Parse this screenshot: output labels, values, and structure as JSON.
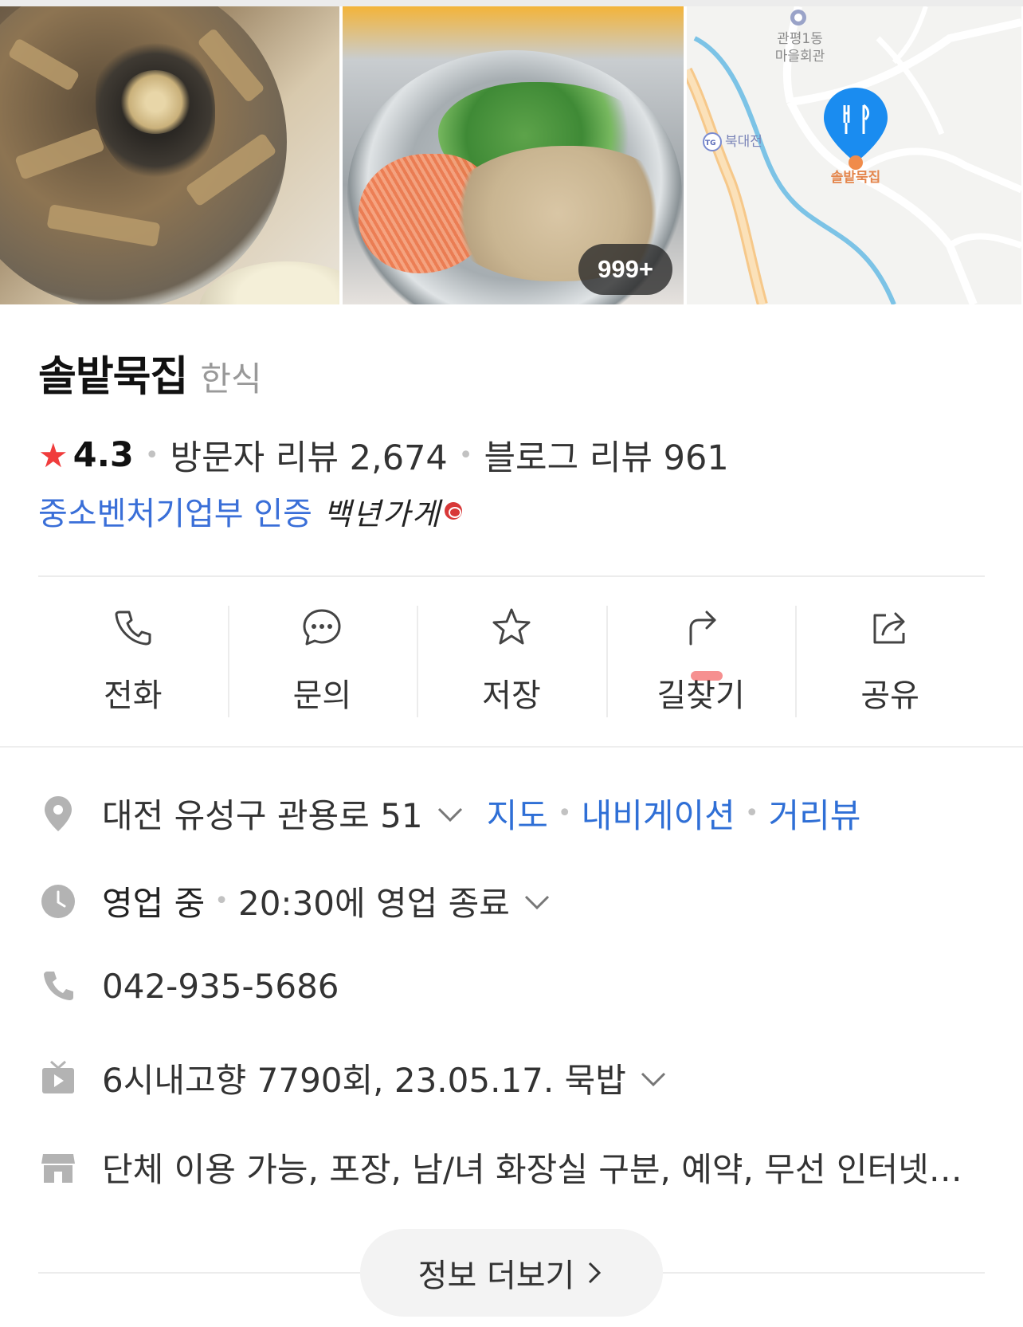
{
  "photos": {
    "count_badge": "999+"
  },
  "map": {
    "landmark": "관평1동\n마을회관",
    "interchange": "북대전",
    "pin_label": "솔밭묵집",
    "ic_badge": "TG"
  },
  "place": {
    "name": "솔밭묵집",
    "category": "한식",
    "rating": "4.3",
    "visitor_review": "방문자 리뷰 2,674",
    "blog_review": "블로그 리뷰 961",
    "certification": "중소벤처기업부 인증",
    "cert_brand": "백년가게"
  },
  "actions": [
    {
      "label": "전화",
      "icon": "phone-icon"
    },
    {
      "label": "문의",
      "icon": "chat-bubble-icon"
    },
    {
      "label": "저장",
      "icon": "star-icon"
    },
    {
      "label": "길찾기",
      "icon": "turn-arrow-icon"
    },
    {
      "label": "공유",
      "icon": "share-icon"
    }
  ],
  "info": {
    "address": "대전 유성구 관용로 51",
    "address_links": [
      "지도",
      "내비게이션",
      "거리뷰"
    ],
    "status": "영업 중",
    "hours": "20:30에 영업 종료",
    "phone": "042-935-5686",
    "tv": "6시내고향 7790회, 23.05.17. 묵밥",
    "amenities": "단체 이용 가능, 포장, 남/녀 화장실 구분, 예약, 무선 인터넷, 주차"
  },
  "more_button": "정보 더보기",
  "colors": {
    "accent_link": "#2f6fd6",
    "star": "#f03c3c",
    "map_pin": "#1a8cf0"
  }
}
